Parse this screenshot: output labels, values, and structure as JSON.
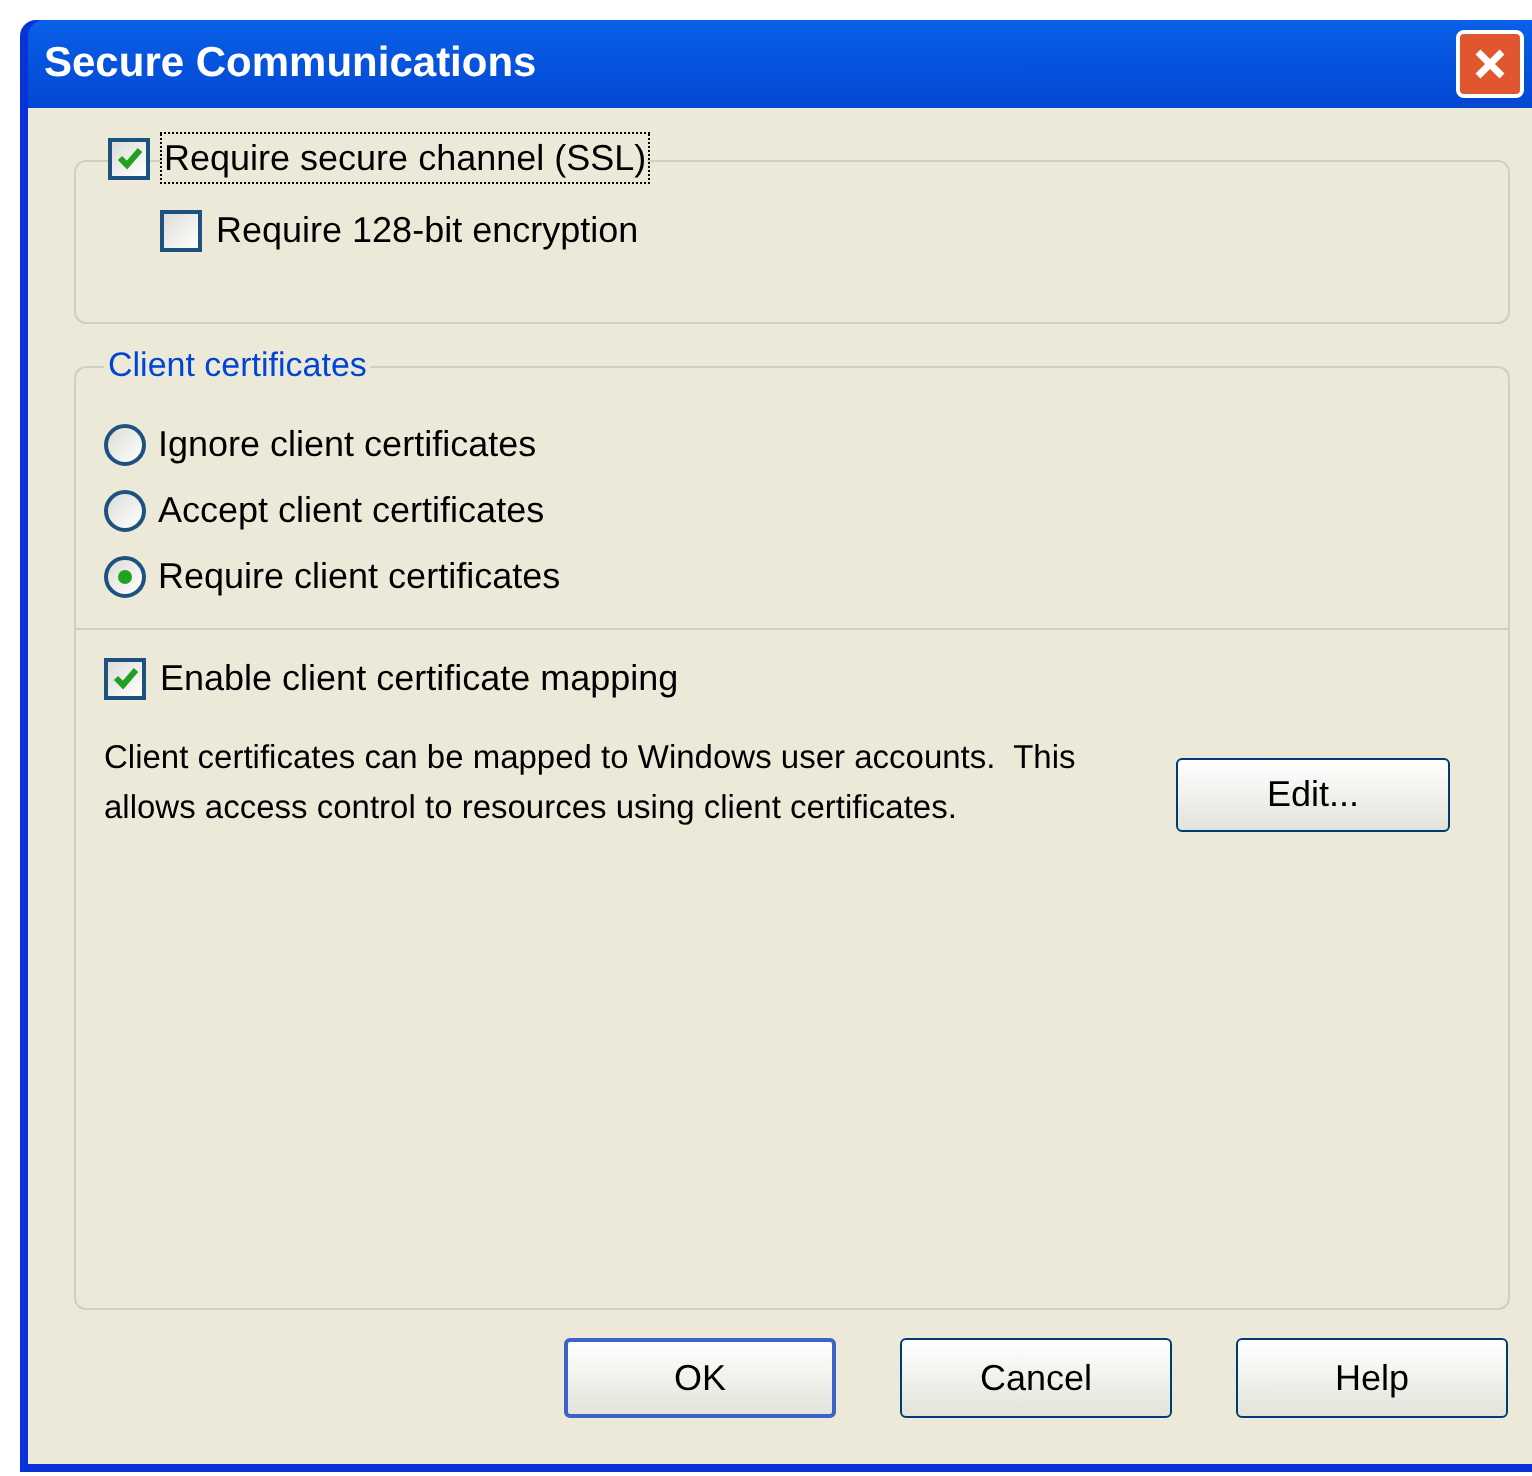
{
  "window": {
    "title": "Secure Communications"
  },
  "ssl": {
    "label": "Require secure channel (SSL)",
    "checked": true
  },
  "encryption": {
    "label": "Require 128-bit encryption",
    "checked": false
  },
  "client_certificates": {
    "legend": "Client certificates",
    "options": [
      {
        "label": "Ignore client certificates",
        "selected": false
      },
      {
        "label": "Accept client certificates",
        "selected": false
      },
      {
        "label": "Require client certificates",
        "selected": true
      }
    ]
  },
  "mapping": {
    "label": "Enable client certificate mapping",
    "checked": true
  },
  "description": "Client certificates can be mapped to Windows user accounts.  This allows access control to resources using client certificates.",
  "edit_button": "Edit...",
  "buttons": [
    "OK",
    "Cancel",
    "Help"
  ]
}
